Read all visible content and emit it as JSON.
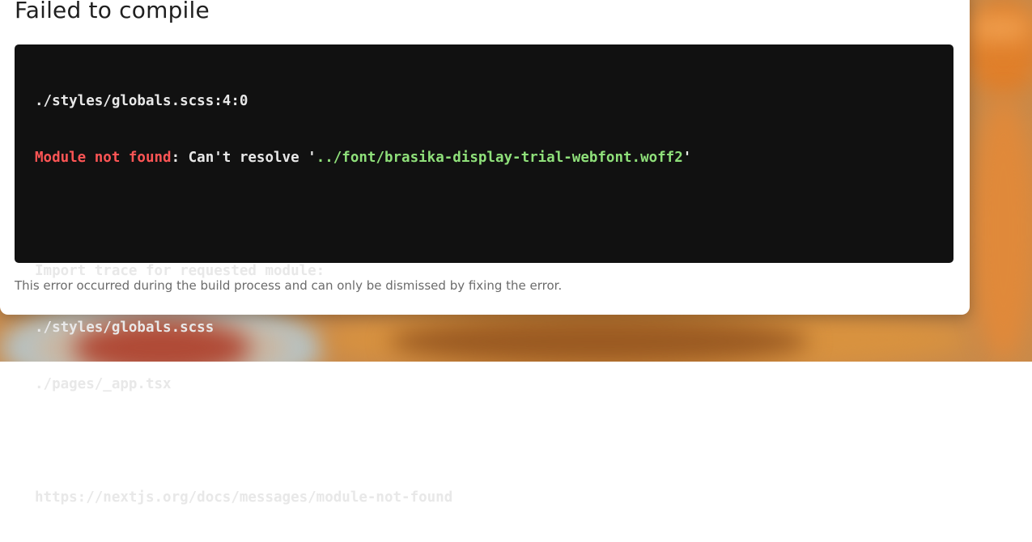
{
  "dialog": {
    "title": "Failed to compile",
    "code": {
      "line1": "./styles/globals.scss:4:0",
      "line2_error_label": "Module not found",
      "line2_middle": ": Can't resolve '",
      "line2_path": "../font/brasika-display-trial-webfont.woff2",
      "line2_end": "'",
      "line3": "",
      "line4": "Import trace for requested module:",
      "line5": "./styles/globals.scss",
      "line6": "./pages/_app.tsx",
      "line7": "",
      "line8": "https://nextjs.org/docs/messages/module-not-found"
    },
    "footer": "This error occurred during the build process and can only be dismissed by fixing the error."
  },
  "colors": {
    "error_label": "#ff5555",
    "path": "#8fe07a",
    "code_background": "#111111"
  }
}
